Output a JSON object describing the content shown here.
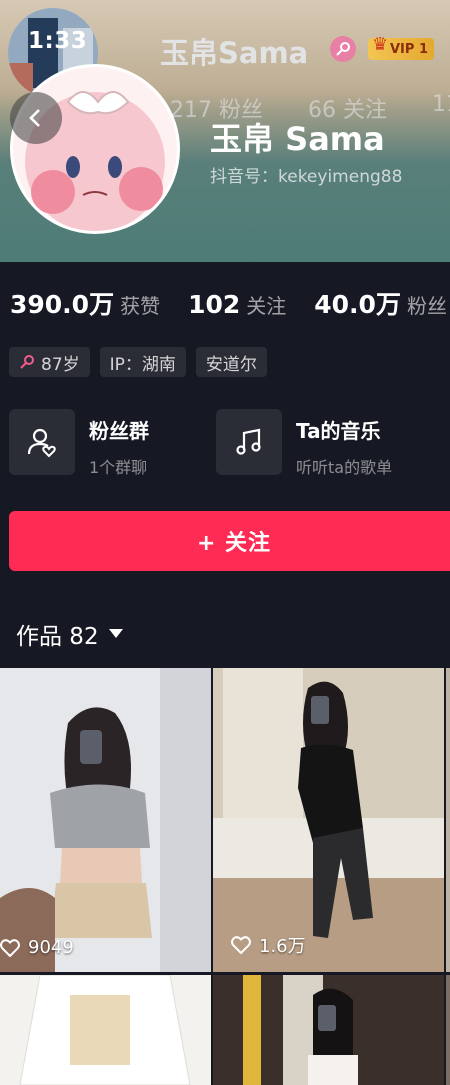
{
  "status_bar": {
    "time": "1:33"
  },
  "header": {
    "mini_name": "玉帛Sama",
    "vip_label": "VIP 1",
    "faded_followers": "217 粉丝",
    "faded_following": "66 关注",
    "faded_extra": "11",
    "name": "玉帛 Sama",
    "douyin_id": "抖音号：kekeyimeng88"
  },
  "stats": [
    {
      "value": "390.0万",
      "label": "获赞"
    },
    {
      "value": "102",
      "label": "关注"
    },
    {
      "value": "40.0万",
      "label": "粉丝"
    }
  ],
  "tags": {
    "age": "87岁",
    "ip": "IP：湖南",
    "city": "安道尔"
  },
  "features": [
    {
      "title": "粉丝群",
      "sub": "1个群聊",
      "icon": "fan-group-icon"
    },
    {
      "title": "Ta的音乐",
      "sub": "听听ta的歌单",
      "icon": "music-note-icon"
    }
  ],
  "follow_button": {
    "label": "+ 关注"
  },
  "works_tab": {
    "label": "作品 82"
  },
  "videos": [
    {
      "likes": "9049"
    },
    {
      "likes": "1.6万"
    }
  ],
  "colors": {
    "background": "#161823",
    "accent": "#fe2c55",
    "card": "#2a2c36"
  }
}
